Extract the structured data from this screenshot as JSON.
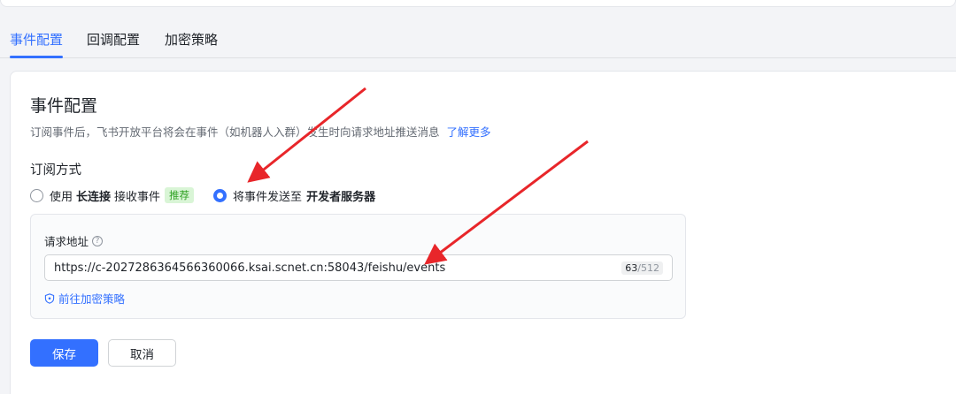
{
  "tabs": [
    {
      "label": "事件配置",
      "active": true
    },
    {
      "label": "回调配置",
      "active": false
    },
    {
      "label": "加密策略",
      "active": false
    }
  ],
  "section": {
    "title": "事件配置",
    "description": "订阅事件后，飞书开放平台将会在事件（如机器人入群）发生时向请求地址推送消息",
    "learn_more": "了解更多"
  },
  "subscription": {
    "title": "订阅方式",
    "option_long": {
      "prefix": "使用",
      "bold": "长连接",
      "suffix": "接收事件",
      "tag": "推荐",
      "checked": false
    },
    "option_server": {
      "prefix": "将事件发送至",
      "bold": "开发者服务器",
      "checked": true
    }
  },
  "request_url": {
    "label": "请求地址",
    "value": "https://c-2027286364566360066.ksai.scnet.cn:58043/feishu/events",
    "count": "63",
    "max": "/512",
    "encrypt_link": "前往加密策略"
  },
  "buttons": {
    "save": "保存",
    "cancel": "取消"
  },
  "colors": {
    "accent": "#3370ff",
    "annotation_arrow": "#e8262a",
    "tag_bg": "#d9f5d6",
    "tag_fg": "#2ea121"
  }
}
